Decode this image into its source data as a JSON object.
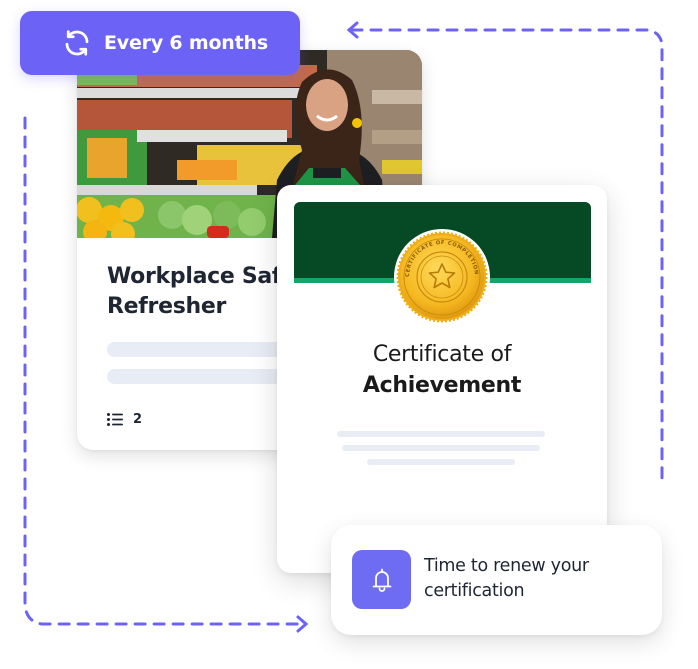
{
  "badge": {
    "icon": "refresh-icon",
    "label": "Every 6 months",
    "color": "#6c63f6"
  },
  "course_card": {
    "image": "grocery-store-employee-photo",
    "title_line1": "Workplace Safe",
    "title_line2": "Refresher",
    "lesson_icon": "list-icon",
    "lesson_count": "2"
  },
  "certificate": {
    "banner_color": "#064a25",
    "stripe_color": "#14a56a",
    "seal": "certificate-of-completion-seal",
    "seal_text": "CERTIFICATE OF COMPLETION",
    "title_line1": "Certificate of",
    "title_line2": "Achievement"
  },
  "notification": {
    "icon": "bell-icon",
    "icon_color": "#6e6cf2",
    "message": "Time to renew your certification"
  },
  "loop_arrow": {
    "color": "#6c63f6"
  }
}
